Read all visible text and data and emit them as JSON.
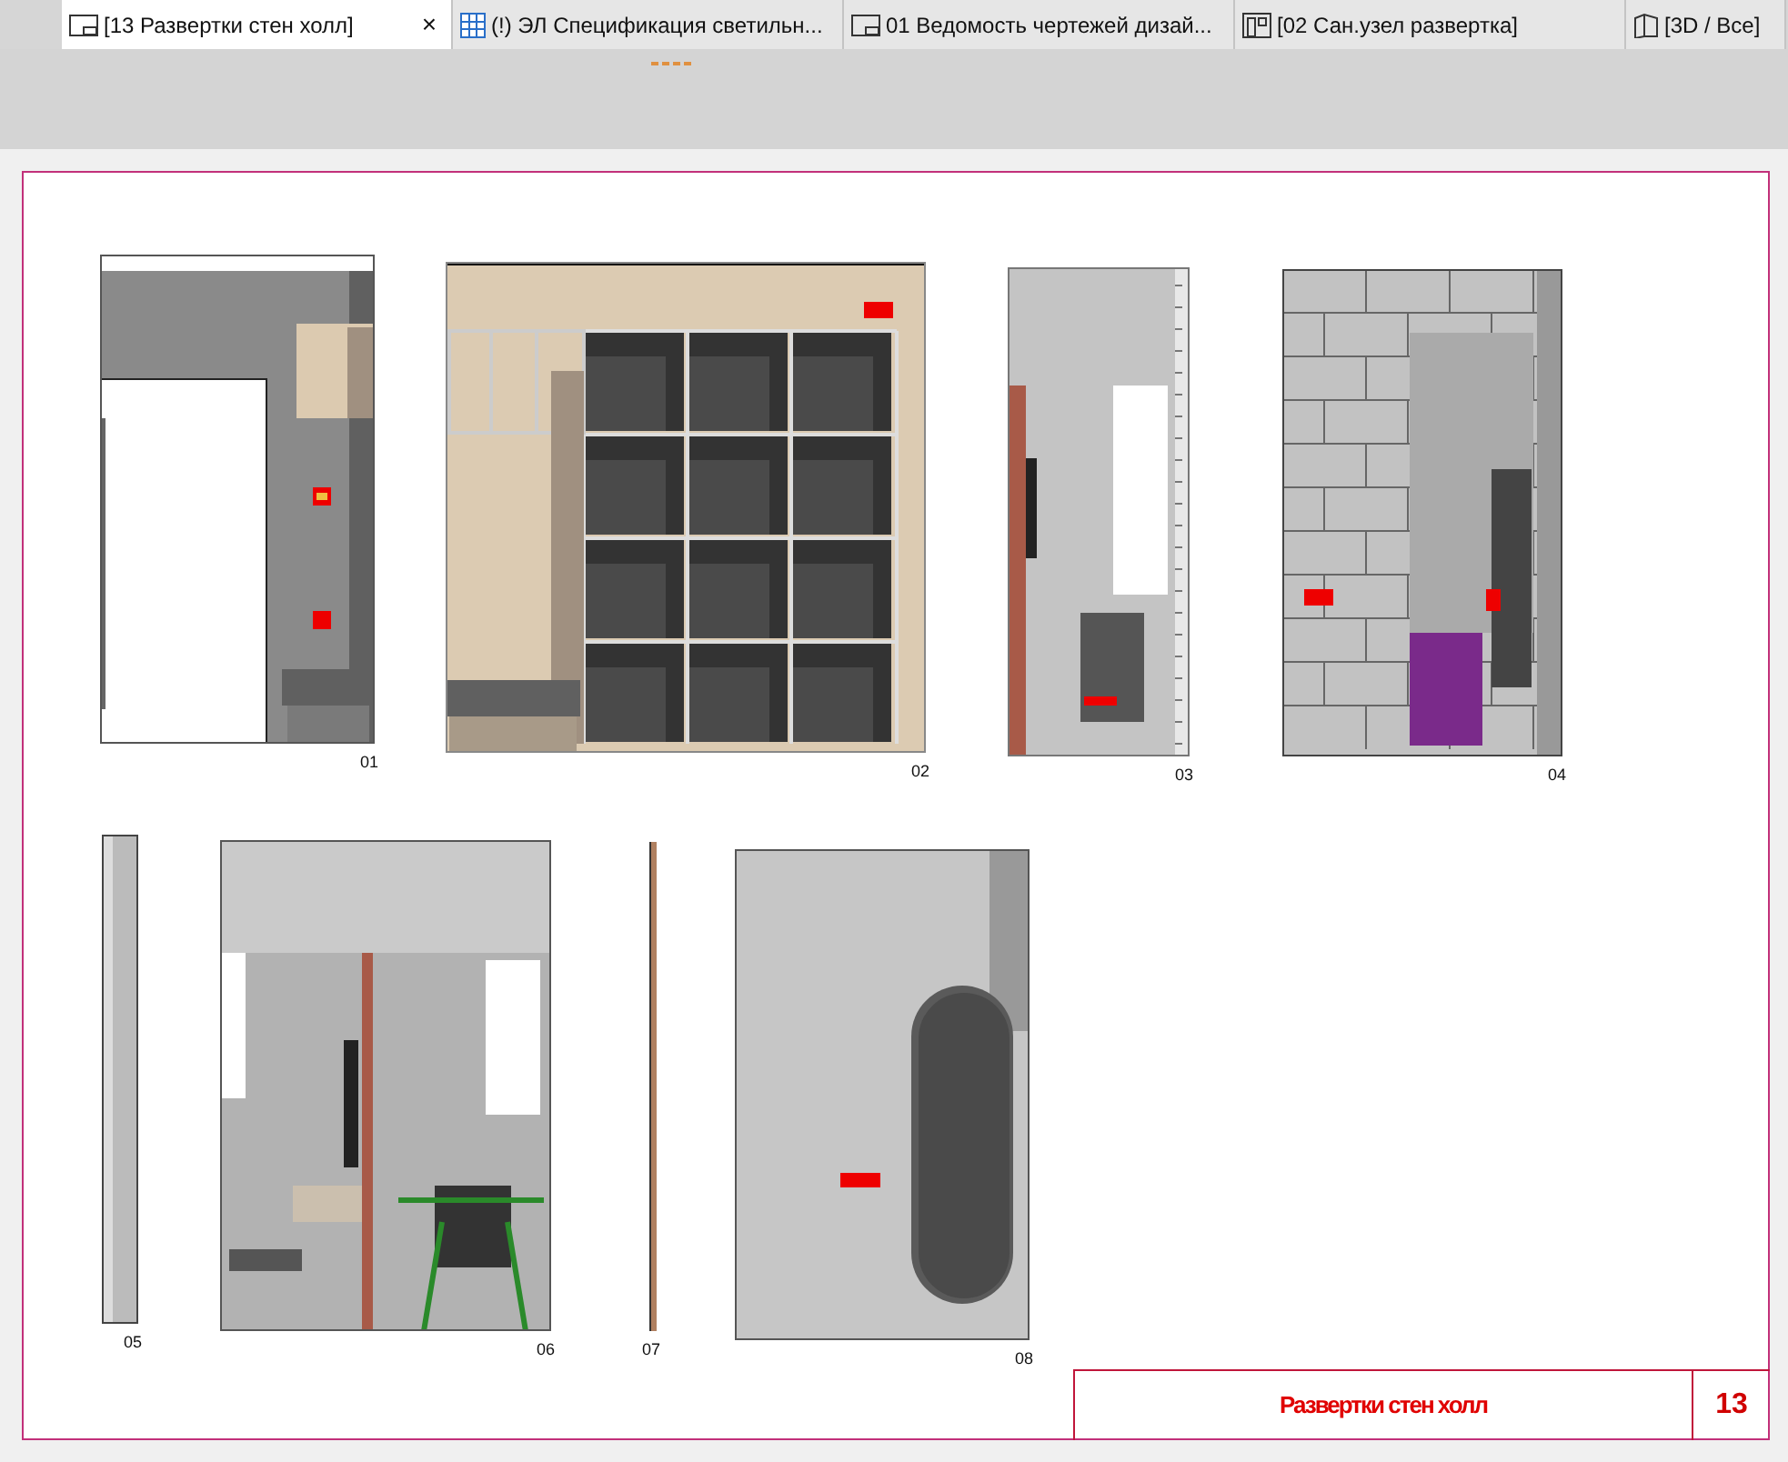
{
  "tabs": [
    {
      "label": "[13 Развертки стен холл]",
      "selected": true,
      "kind": "layout",
      "close": "×"
    },
    {
      "label": "(!) ЭЛ Спецификация светильн...",
      "selected": false,
      "kind": "schedule"
    },
    {
      "label": "01 Ведомость чертежей дизай...",
      "selected": false,
      "kind": "layout"
    },
    {
      "label": "[02 Сан.узел развертка]",
      "selected": false,
      "kind": "elevation"
    },
    {
      "label": "[3D / Все]",
      "selected": false,
      "kind": "cube"
    }
  ],
  "drawings": [
    {
      "label": "01",
      "kind": "door-wall"
    },
    {
      "label": "02",
      "kind": "wardrobe"
    },
    {
      "label": "03",
      "kind": "bathroom"
    },
    {
      "label": "04",
      "kind": "tile-wall"
    },
    {
      "label": "05",
      "kind": "strip"
    },
    {
      "label": "06",
      "kind": "desk"
    },
    {
      "label": "07",
      "kind": "line"
    },
    {
      "label": "08",
      "kind": "oval-wall"
    }
  ],
  "title_block": {
    "title": "Развертки стен холл",
    "number": "13"
  }
}
